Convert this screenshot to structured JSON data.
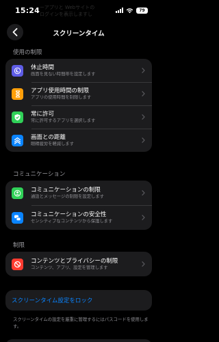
{
  "status_bar": {
    "time": "15:24",
    "battery": "79"
  },
  "background_text": "ーアプリと Webサイトの\nログインを表示しますし",
  "nav": {
    "title": "スクリーンタイム"
  },
  "sections": {
    "limits_header": "使用の制限",
    "communication_header": "コミュニケーション",
    "restrictions_header": "制限"
  },
  "limits": [
    {
      "title": "休止時間",
      "subtitle": "画面を見ない時間帯を設定します",
      "icon": "moon-icon",
      "color": "#5e5ce6"
    },
    {
      "title": "アプリ使用時間の制限",
      "subtitle": "アプリの使用時間を制限します",
      "icon": "hourglass-icon",
      "color": "#ff9f0a"
    },
    {
      "title": "常に許可",
      "subtitle": "常に許可するアプリを選択します",
      "icon": "checkmark-icon",
      "color": "#30d158"
    },
    {
      "title": "画面との距離",
      "subtitle": "眼精疲労を軽減します",
      "icon": "distance-icon",
      "color": "#0a84ff"
    }
  ],
  "communication": [
    {
      "title": "コミュニケーションの制限",
      "subtitle": "通話とメッセージの制限を設定します",
      "icon": "person-icon",
      "color": "#30d158"
    },
    {
      "title": "コミュニケーションの安全性",
      "subtitle": "センシティブなコンテンツから保護します",
      "icon": "chat-bubbles-icon",
      "color": "#0a84ff"
    }
  ],
  "restrictions": [
    {
      "title": "コンテンツとプライバシーの制限",
      "subtitle": "コンテンツ、アプリ、設定を管理します",
      "icon": "restricted-icon",
      "color": "#ff3b30"
    }
  ],
  "lock": {
    "label": "スクリーンタイム設定をロック"
  },
  "footnote": "スクリーンタイムの設定を厳重に管理するにはパスコードを使用します。"
}
